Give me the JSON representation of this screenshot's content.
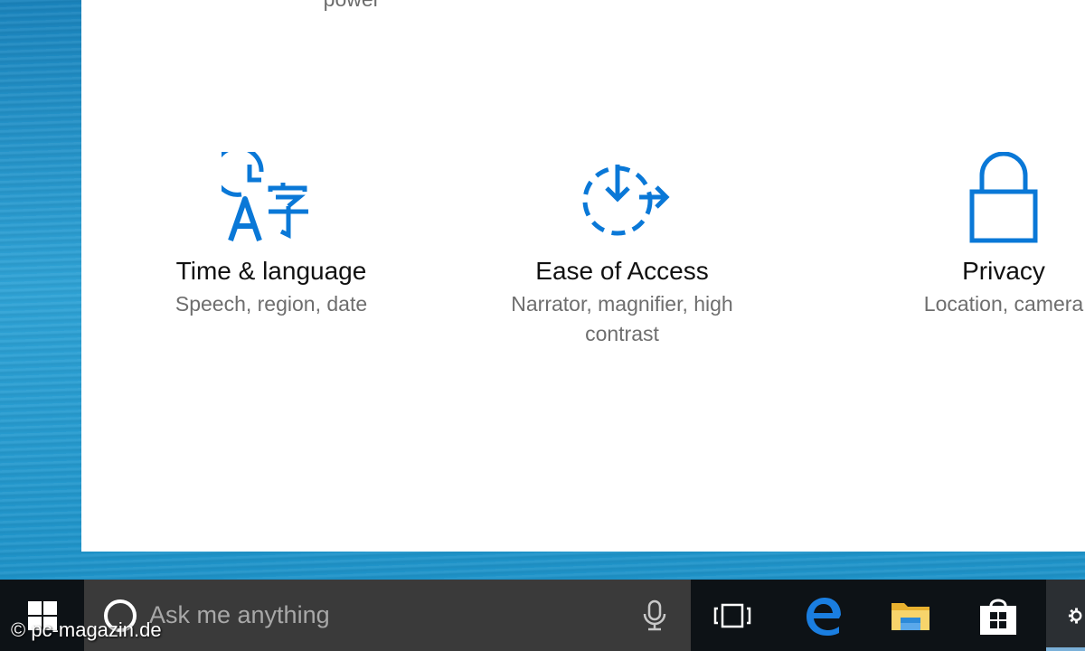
{
  "window": {
    "cut_off_text": "power",
    "tiles": [
      {
        "title": "Time & language",
        "desc": "Speech, region, date",
        "icon": "time-language-icon"
      },
      {
        "title": "Ease of Access",
        "desc_line1": "Narrator, magnifier, high",
        "desc_line2": "contrast",
        "icon": "ease-of-access-icon"
      },
      {
        "title": "Privacy",
        "desc": "Location, camera",
        "icon": "lock-icon"
      }
    ],
    "accent_color": "#0a78d7"
  },
  "taskbar": {
    "search_placeholder": "Ask me anything",
    "icons": [
      "windows-logo-icon",
      "cortana-icon",
      "microphone-icon",
      "task-view-icon",
      "edge-icon",
      "file-explorer-icon",
      "store-icon",
      "gear-icon"
    ]
  },
  "watermark": "© pc-magazin.de"
}
